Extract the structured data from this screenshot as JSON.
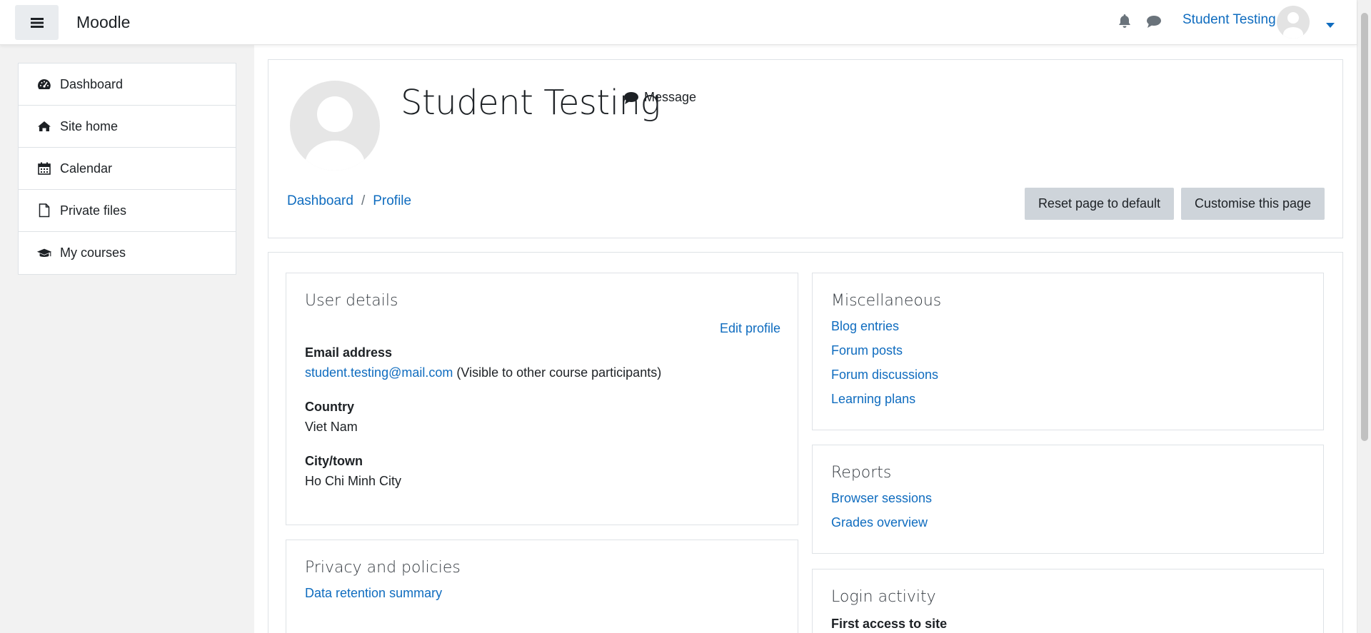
{
  "navbar": {
    "brand": "Moodle",
    "user_name": "Student Testing"
  },
  "sidebar": {
    "items": [
      {
        "label": "Dashboard",
        "icon": "dashboard-icon"
      },
      {
        "label": "Site home",
        "icon": "home-icon"
      },
      {
        "label": "Calendar",
        "icon": "calendar-icon"
      },
      {
        "label": "Private files",
        "icon": "file-icon"
      },
      {
        "label": "My courses",
        "icon": "graduation-cap-icon"
      }
    ]
  },
  "profile": {
    "name": "Student Testing",
    "message_label": "Message",
    "breadcrumb": [
      "Dashboard",
      "Profile"
    ],
    "breadcrumb_separator": "/",
    "reset_button": "Reset page to default",
    "customise_button": "Customise this page"
  },
  "user_details": {
    "title": "User details",
    "edit_profile": "Edit profile",
    "email_label": "Email address",
    "email_value": "student.testing@mail.com",
    "email_note": "(Visible to other course participants)",
    "country_label": "Country",
    "country_value": "Viet Nam",
    "city_label": "City/town",
    "city_value": "Ho Chi Minh City"
  },
  "privacy": {
    "title": "Privacy and policies",
    "link": "Data retention summary"
  },
  "miscellaneous": {
    "title": "Miscellaneous",
    "links": [
      "Blog entries",
      "Forum posts",
      "Forum discussions",
      "Learning plans"
    ]
  },
  "reports": {
    "title": "Reports",
    "links": [
      "Browser sessions",
      "Grades overview"
    ]
  },
  "login_activity": {
    "title": "Login activity",
    "first_access_label": "First access to site"
  },
  "colors": {
    "link": "#0f6cbf",
    "button_bg": "#ced4da",
    "page_bg": "#f2f2f2"
  }
}
